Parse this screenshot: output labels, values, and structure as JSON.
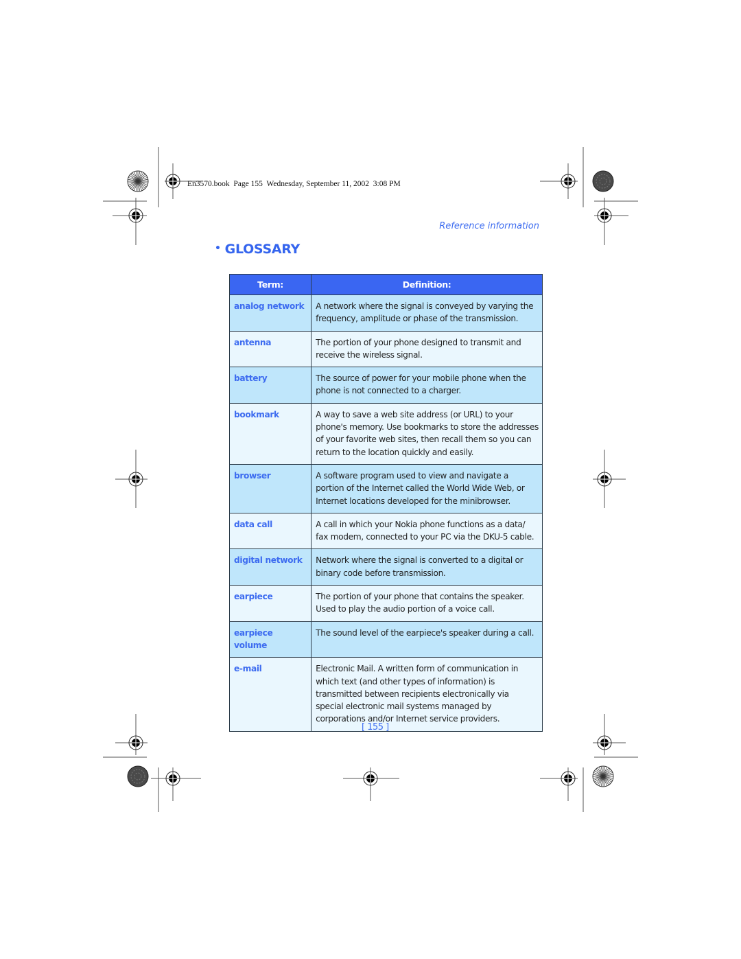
{
  "header": {
    "slug": "En3570.book  Page 155  Wednesday, September 11, 2002  3:08 PM",
    "section_label": "Reference information"
  },
  "title": {
    "bullet": "•",
    "text": "GLOSSARY"
  },
  "table": {
    "columns": [
      "Term:",
      "Definition:"
    ],
    "rows": [
      {
        "term": "analog network",
        "lines": [
          "A network where the signal is conveyed by varying the",
          "frequency, amplitude or phase of the transmission."
        ]
      },
      {
        "term": "antenna",
        "lines": [
          "The portion of your phone designed to transmit and",
          "receive the wireless signal."
        ]
      },
      {
        "term": "battery",
        "lines": [
          "The source of power for your mobile phone when the",
          "phone is not connected to a charger."
        ]
      },
      {
        "term": "bookmark",
        "lines": [
          "A way to save a web site address (or URL) to your",
          "phone's memory. Use bookmarks to store the addresses",
          "of your favorite web sites, then recall them so you can",
          "return to the location quickly and easily."
        ]
      },
      {
        "term": "browser",
        "lines": [
          "A software program used to view and navigate a",
          "portion of the Internet called the World Wide Web, or",
          "Internet locations developed for the minibrowser."
        ]
      },
      {
        "term": "data call",
        "lines": [
          "A call in which your Nokia phone functions as a data/",
          "fax modem, connected to your PC via the DKU-5 cable."
        ]
      },
      {
        "term": "digital network",
        "lines": [
          "Network where the signal is converted to a digital or",
          "binary code before transmission."
        ]
      },
      {
        "term": "earpiece",
        "lines": [
          "The portion of your phone that contains the speaker.",
          "Used to play the audio portion of a voice call."
        ]
      },
      {
        "term": "earpiece volume",
        "lines": [
          "The sound level of the earpiece's speaker during a call."
        ]
      },
      {
        "term": "e-mail",
        "lines": [
          "Electronic Mail. A written form of communication in",
          "which text (and other types of information) is",
          "transmitted between recipients electronically via",
          "special electronic mail systems managed by",
          "corporations and/or Internet service providers."
        ]
      }
    ]
  },
  "footer": {
    "page_number": "[ 155 ]"
  },
  "icons": {
    "registration_mark": "crosshair-target-icon",
    "starburst": "starburst-icon",
    "dark_disc": "color-bar-disc-icon"
  },
  "colors": {
    "accent_blue": "#3d6cf0",
    "header_blue": "#3a66f2",
    "row_dark": "#bfe6fb",
    "row_light": "#eaf7fe"
  }
}
